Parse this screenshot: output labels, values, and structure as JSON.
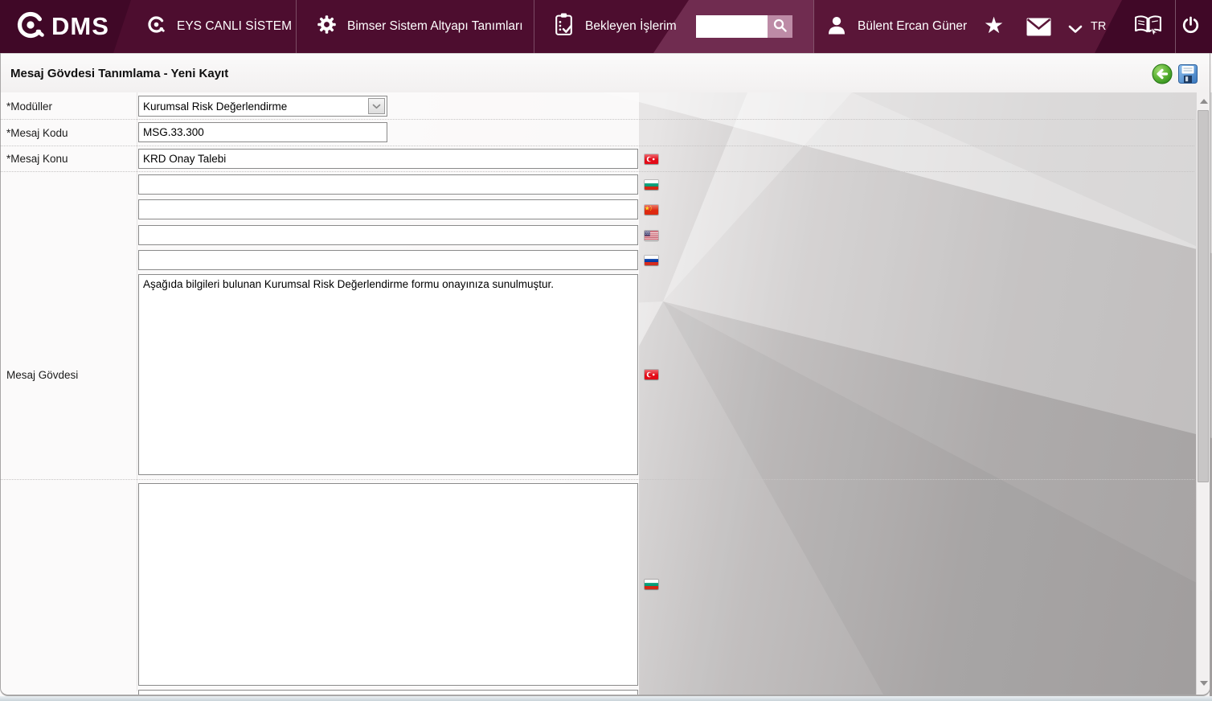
{
  "header": {
    "logo": {
      "text": "DMS",
      "icon": "qdms-logo-icon"
    },
    "menu_items": [
      {
        "label": "EYS CANLI SİSTEM",
        "icon": "qdms-ring-icon"
      },
      {
        "label": "Bimser Sistem Altyapı Tanımları",
        "icon": "gear-icon"
      },
      {
        "label": "Bekleyen İşlerim",
        "icon": "clipboard-check-icon"
      }
    ],
    "search": {
      "value": "",
      "icon": "search-icon"
    },
    "user": {
      "name": "Bülent Ercan Güner",
      "icon": "user-icon"
    },
    "language": {
      "code": "TR",
      "icon": "chevron-down-icon"
    },
    "action_icons": [
      "star-icon",
      "mail-icon",
      "manual-icon",
      "power-icon"
    ],
    "colors": {
      "bar": "#4d0d2f",
      "bar_dark": "#400827",
      "search_block": "#702c50",
      "search_button": "#bd8ba6",
      "user_block": "#5a1638"
    }
  },
  "titlebar": {
    "title": "Mesaj Gövdesi Tanımlama - Yeni Kayıt",
    "actions": [
      {
        "name": "back",
        "icon": "back-icon",
        "color": "#46a935"
      },
      {
        "name": "save",
        "icon": "save-icon",
        "color": "#4a90d9"
      }
    ]
  },
  "form": {
    "moduller": {
      "label": "*Modüller",
      "value": "Kurumsal Risk Değerlendirme"
    },
    "mesaj_kodu": {
      "label": "*Mesaj Kodu",
      "value": "MSG.33.300"
    },
    "mesaj_konu": {
      "label": "*Mesaj Konu",
      "values": {
        "turkish": "KRD Onay Talebi",
        "bulgarian": "",
        "chinese": "",
        "english_us": "",
        "russian": ""
      }
    },
    "mesaj_govdesi": {
      "label": "Mesaj Gövdesi",
      "values": {
        "turkish": "Aşağıda bilgileri bulunan Kurumsal Risk Değerlendirme formu onayınıza sunulmuştur.",
        "bulgarian": ""
      }
    },
    "flag_icons": [
      "turkey-flag-icon",
      "bulgaria-flag-icon",
      "china-flag-icon",
      "usa-flag-icon",
      "russia-flag-icon"
    ]
  }
}
